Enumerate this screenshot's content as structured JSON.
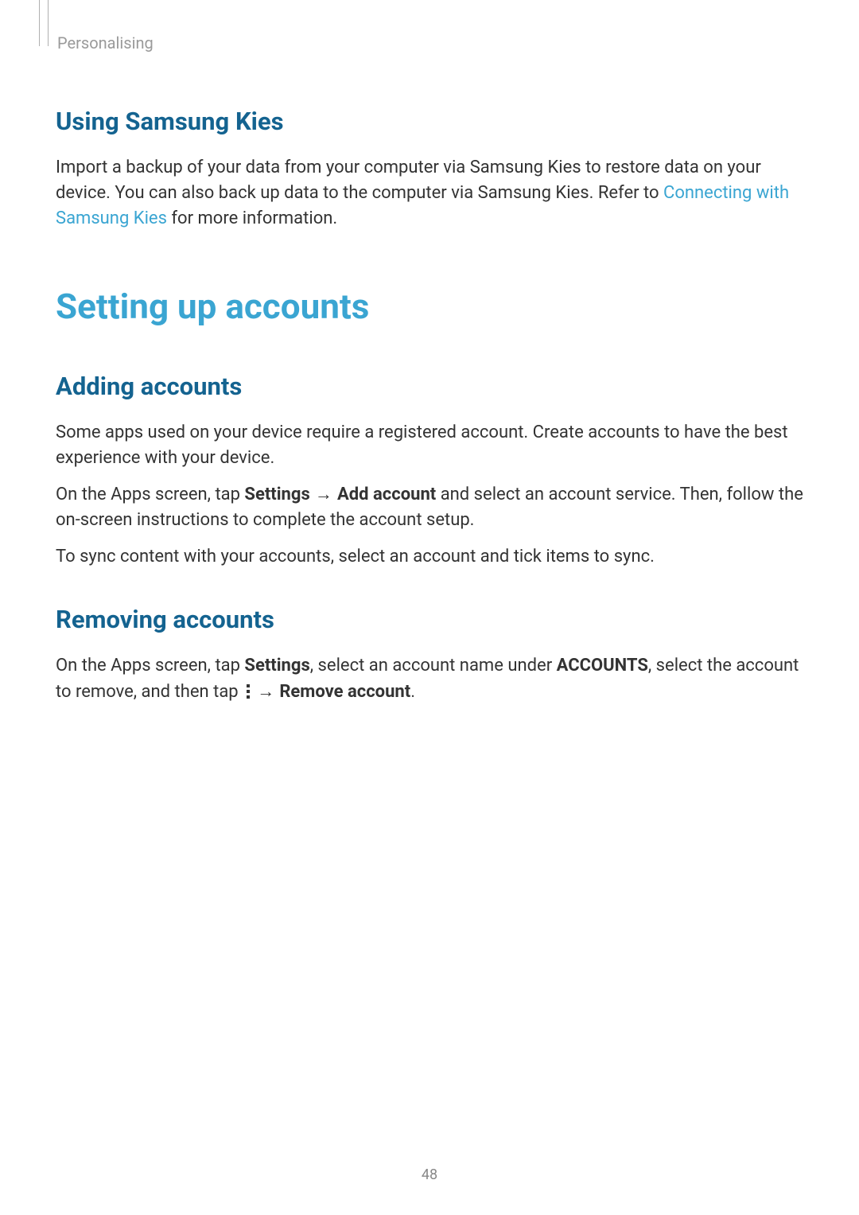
{
  "breadcrumb": "Personalising",
  "section1": {
    "heading": "Using Samsung Kies",
    "para1_pre": "Import a backup of your data from your computer via Samsung Kies to restore data on your device. You can also back up data to the computer via Samsung Kies. Refer to ",
    "para1_link": "Connecting with Samsung Kies",
    "para1_post": " for more information."
  },
  "section2": {
    "heading": "Setting up accounts"
  },
  "section3": {
    "heading": "Adding accounts",
    "para1": "Some apps used on your device require a registered account. Create accounts to have the best experience with your device.",
    "para2_pre": "On the Apps screen, tap ",
    "para2_bold1": "Settings",
    "para2_mid1": " → ",
    "para2_bold2": "Add account",
    "para2_post": " and select an account service. Then, follow the on-screen instructions to complete the account setup.",
    "para3": "To sync content with your accounts, select an account and tick items to sync."
  },
  "section4": {
    "heading": "Removing accounts",
    "para1_pre": "On the Apps screen, tap ",
    "para1_bold1": "Settings",
    "para1_mid1": ", select an account name under ",
    "para1_bold2": "ACCOUNTS",
    "para1_mid2": ", select the account to remove, and then tap ",
    "para1_mid3": " → ",
    "para1_bold3": "Remove account",
    "para1_post": "."
  },
  "page_number": "48"
}
